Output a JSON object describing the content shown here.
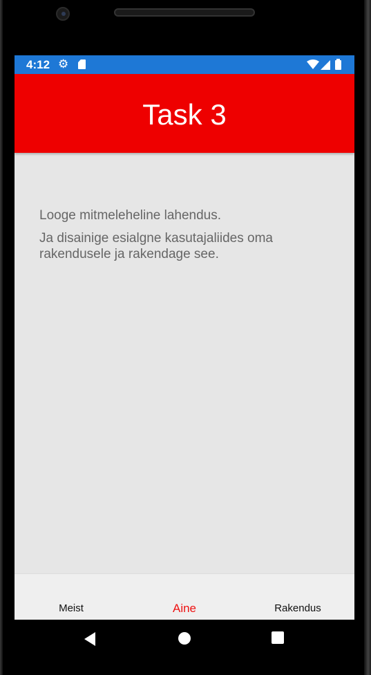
{
  "status_bar": {
    "time": "4:12",
    "left_icons": [
      "gear-icon",
      "sd-card-icon"
    ],
    "right_icons": [
      "wifi-icon",
      "signal-icon",
      "battery-icon"
    ],
    "color": "#1e78d6"
  },
  "app_bar": {
    "title": "Task 3",
    "color": "#ee0000"
  },
  "content": {
    "line1": "Looge mitmeleheline lahendus.",
    "line2": "Ja disainige esialgne kasutajaliides oma rakendusele ja rakendage see."
  },
  "bottom_nav": {
    "tabs": [
      {
        "label": "Meist",
        "active": false
      },
      {
        "label": "Aine",
        "active": true
      },
      {
        "label": "Rakendus",
        "active": false
      }
    ],
    "active_color": "#ee1111"
  },
  "system_nav": {
    "buttons": [
      "back-icon",
      "home-icon",
      "recents-icon"
    ]
  }
}
